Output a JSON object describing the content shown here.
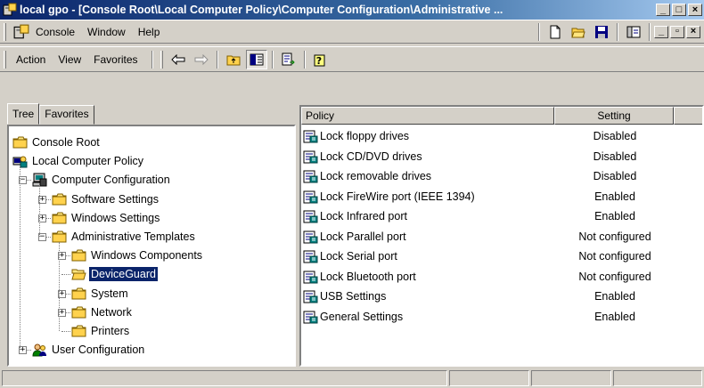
{
  "window": {
    "title": "local gpo - [Console Root\\Local Computer Policy\\Computer Configuration\\Administrative ...",
    "buttons": [
      "_",
      "□",
      "×"
    ]
  },
  "menubar": {
    "items": [
      {
        "label": "Console",
        "icon": "console-icon"
      },
      {
        "label": "Window"
      },
      {
        "label": "Help"
      }
    ],
    "mdi_buttons": [
      "_",
      "▫",
      "×"
    ]
  },
  "actionbar": {
    "items": [
      {
        "label": "Action"
      },
      {
        "label": "View"
      },
      {
        "label": "Favorites"
      }
    ],
    "tools": [
      "back-arrow-icon",
      "forward-arrow-icon",
      "up-folder-icon",
      "show-hide-tree-icon",
      "export-list-icon",
      "help-icon"
    ]
  },
  "tabs": [
    {
      "label": "Tree",
      "active": true
    },
    {
      "label": "Favorites",
      "active": false
    }
  ],
  "tree": [
    {
      "label": "Console Root",
      "icon": "folder-icon",
      "level": 0,
      "expander": ""
    },
    {
      "label": "Local Computer Policy",
      "icon": "policy-icon",
      "level": 0,
      "expander": "-"
    },
    {
      "label": "Computer Configuration",
      "icon": "computer-icon",
      "level": 1,
      "expander": "-"
    },
    {
      "label": "Software Settings",
      "icon": "folder-icon",
      "level": 2,
      "expander": "+"
    },
    {
      "label": "Windows Settings",
      "icon": "folder-icon",
      "level": 2,
      "expander": "+"
    },
    {
      "label": "Administrative Templates",
      "icon": "folder-icon",
      "level": 2,
      "expander": "-"
    },
    {
      "label": "Windows Components",
      "icon": "folder-icon",
      "level": 3,
      "expander": "+"
    },
    {
      "label": "DeviceGuard",
      "icon": "folder-open-icon",
      "level": 3,
      "expander": "",
      "selected": true
    },
    {
      "label": "System",
      "icon": "folder-icon",
      "level": 3,
      "expander": "+"
    },
    {
      "label": "Network",
      "icon": "folder-icon",
      "level": 3,
      "expander": "+"
    },
    {
      "label": "Printers",
      "icon": "folder-icon",
      "level": 3,
      "expander": ""
    },
    {
      "label": "User Configuration",
      "icon": "user-icon",
      "level": 1,
      "expander": "+"
    }
  ],
  "list": {
    "columns": [
      "Policy",
      "Setting"
    ],
    "rows": [
      {
        "policy": "Lock floppy drives",
        "setting": "Disabled"
      },
      {
        "policy": "Lock CD/DVD drives",
        "setting": "Disabled"
      },
      {
        "policy": "Lock removable drives",
        "setting": "Disabled"
      },
      {
        "policy": "Lock FireWire port (IEEE 1394)",
        "setting": "Enabled"
      },
      {
        "policy": "Lock Infrared port",
        "setting": "Enabled"
      },
      {
        "policy": "Lock Parallel port",
        "setting": "Not configured"
      },
      {
        "policy": "Lock Serial port",
        "setting": "Not configured"
      },
      {
        "policy": "Lock Bluetooth port",
        "setting": "Not configured"
      },
      {
        "policy": "USB Settings",
        "setting": "Enabled"
      },
      {
        "policy": "General Settings",
        "setting": "Enabled"
      }
    ]
  },
  "colors": {
    "title_start": "#0a246a",
    "title_end": "#a6caf0",
    "selection": "#0a246a",
    "face": "#d4d0c8"
  }
}
